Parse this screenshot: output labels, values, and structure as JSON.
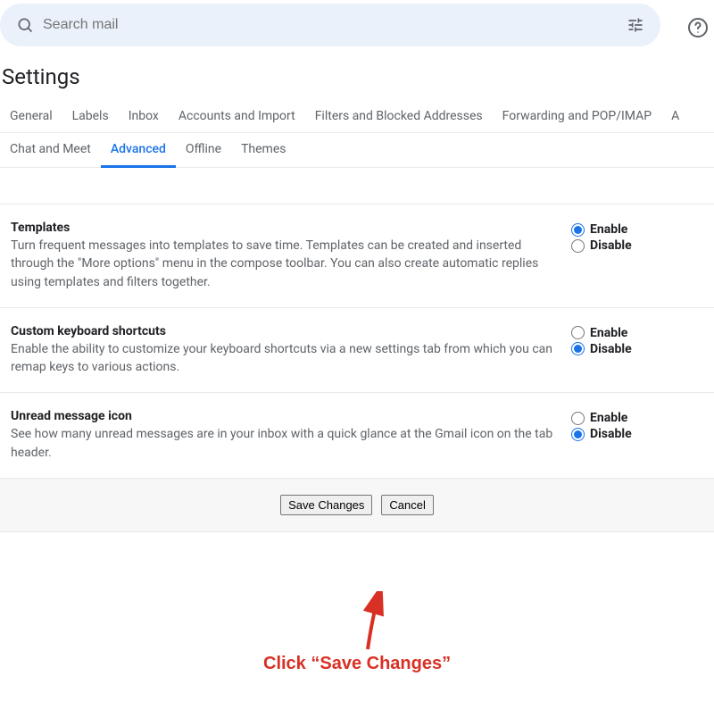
{
  "search": {
    "placeholder": "Search mail"
  },
  "page": {
    "title": "Settings"
  },
  "tabs": {
    "row1": [
      {
        "label": "General",
        "name": "tab-general"
      },
      {
        "label": "Labels",
        "name": "tab-labels"
      },
      {
        "label": "Inbox",
        "name": "tab-inbox"
      },
      {
        "label": "Accounts and Import",
        "name": "tab-accounts"
      },
      {
        "label": "Filters and Blocked Addresses",
        "name": "tab-filters"
      },
      {
        "label": "Forwarding and POP/IMAP",
        "name": "tab-forwarding"
      },
      {
        "label": "A",
        "name": "tab-addons-partial"
      }
    ],
    "row2": [
      {
        "label": "Chat and Meet",
        "name": "tab-chat-meet"
      },
      {
        "label": "Advanced",
        "name": "tab-advanced",
        "active": true
      },
      {
        "label": "Offline",
        "name": "tab-offline"
      },
      {
        "label": "Themes",
        "name": "tab-themes"
      }
    ]
  },
  "sections": [
    {
      "title": "Templates",
      "text": "Turn frequent messages into templates to save time. Templates can be created and inserted through the \"More options\" menu in the compose toolbar. You can also create automatic replies using templates and filters together.",
      "enable_label": "Enable",
      "disable_label": "Disable",
      "selected": "enable"
    },
    {
      "title": "Custom keyboard shortcuts",
      "text": "Enable the ability to customize your keyboard shortcuts via a new settings tab from which you can remap keys to various actions.",
      "enable_label": "Enable",
      "disable_label": "Disable",
      "selected": "disable"
    },
    {
      "title": "Unread message icon",
      "text": "See how many unread messages are in your inbox with a quick glance at the Gmail icon on the tab header.",
      "enable_label": "Enable",
      "disable_label": "Disable",
      "selected": "disable"
    }
  ],
  "buttons": {
    "save": "Save Changes",
    "cancel": "Cancel"
  },
  "annotation": {
    "text": "Click “Save Changes”"
  }
}
